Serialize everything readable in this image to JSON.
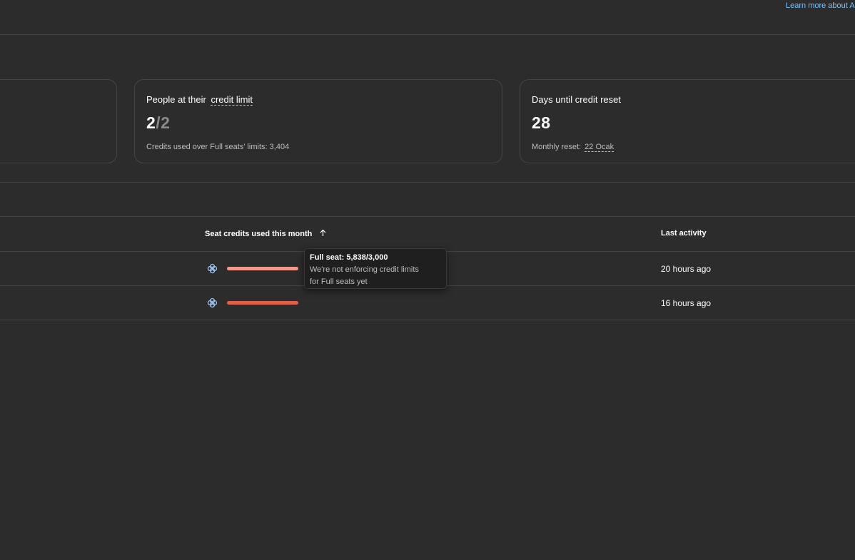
{
  "header": {
    "learn_more_link": "Learn more about A"
  },
  "cards": [
    {
      "title_prefix": "People at their",
      "title_link": "credit limit",
      "value_main": "2",
      "value_rest": "/2",
      "subtext": "Credits used over Full seats' limits: 3,404"
    },
    {
      "title": "Days until credit reset",
      "value": "28",
      "subtext_prefix": "Monthly reset:",
      "subtext_link": "22 Ocak"
    }
  ],
  "table": {
    "columns": {
      "seat_credits": "Seat credits used this month",
      "last_activity": "Last activity"
    },
    "rows": [
      {
        "seat_icon": "full-seat-icon",
        "usage_fraction": 1.0,
        "bar_color": "#f4998d",
        "last_activity": "20 hours ago"
      },
      {
        "seat_icon": "full-seat-icon",
        "usage_fraction": 1.0,
        "bar_color": "#e0614a",
        "last_activity": "16 hours ago"
      }
    ]
  },
  "tooltip": {
    "title": "Full seat: 5,838/3,000",
    "line1": "We're not enforcing credit limits",
    "line2": "for Full seats yet"
  },
  "colors": {
    "background": "#2c2c2c",
    "border": "#454545",
    "link": "#7cc4fa",
    "icon": "#9cc4ec"
  }
}
